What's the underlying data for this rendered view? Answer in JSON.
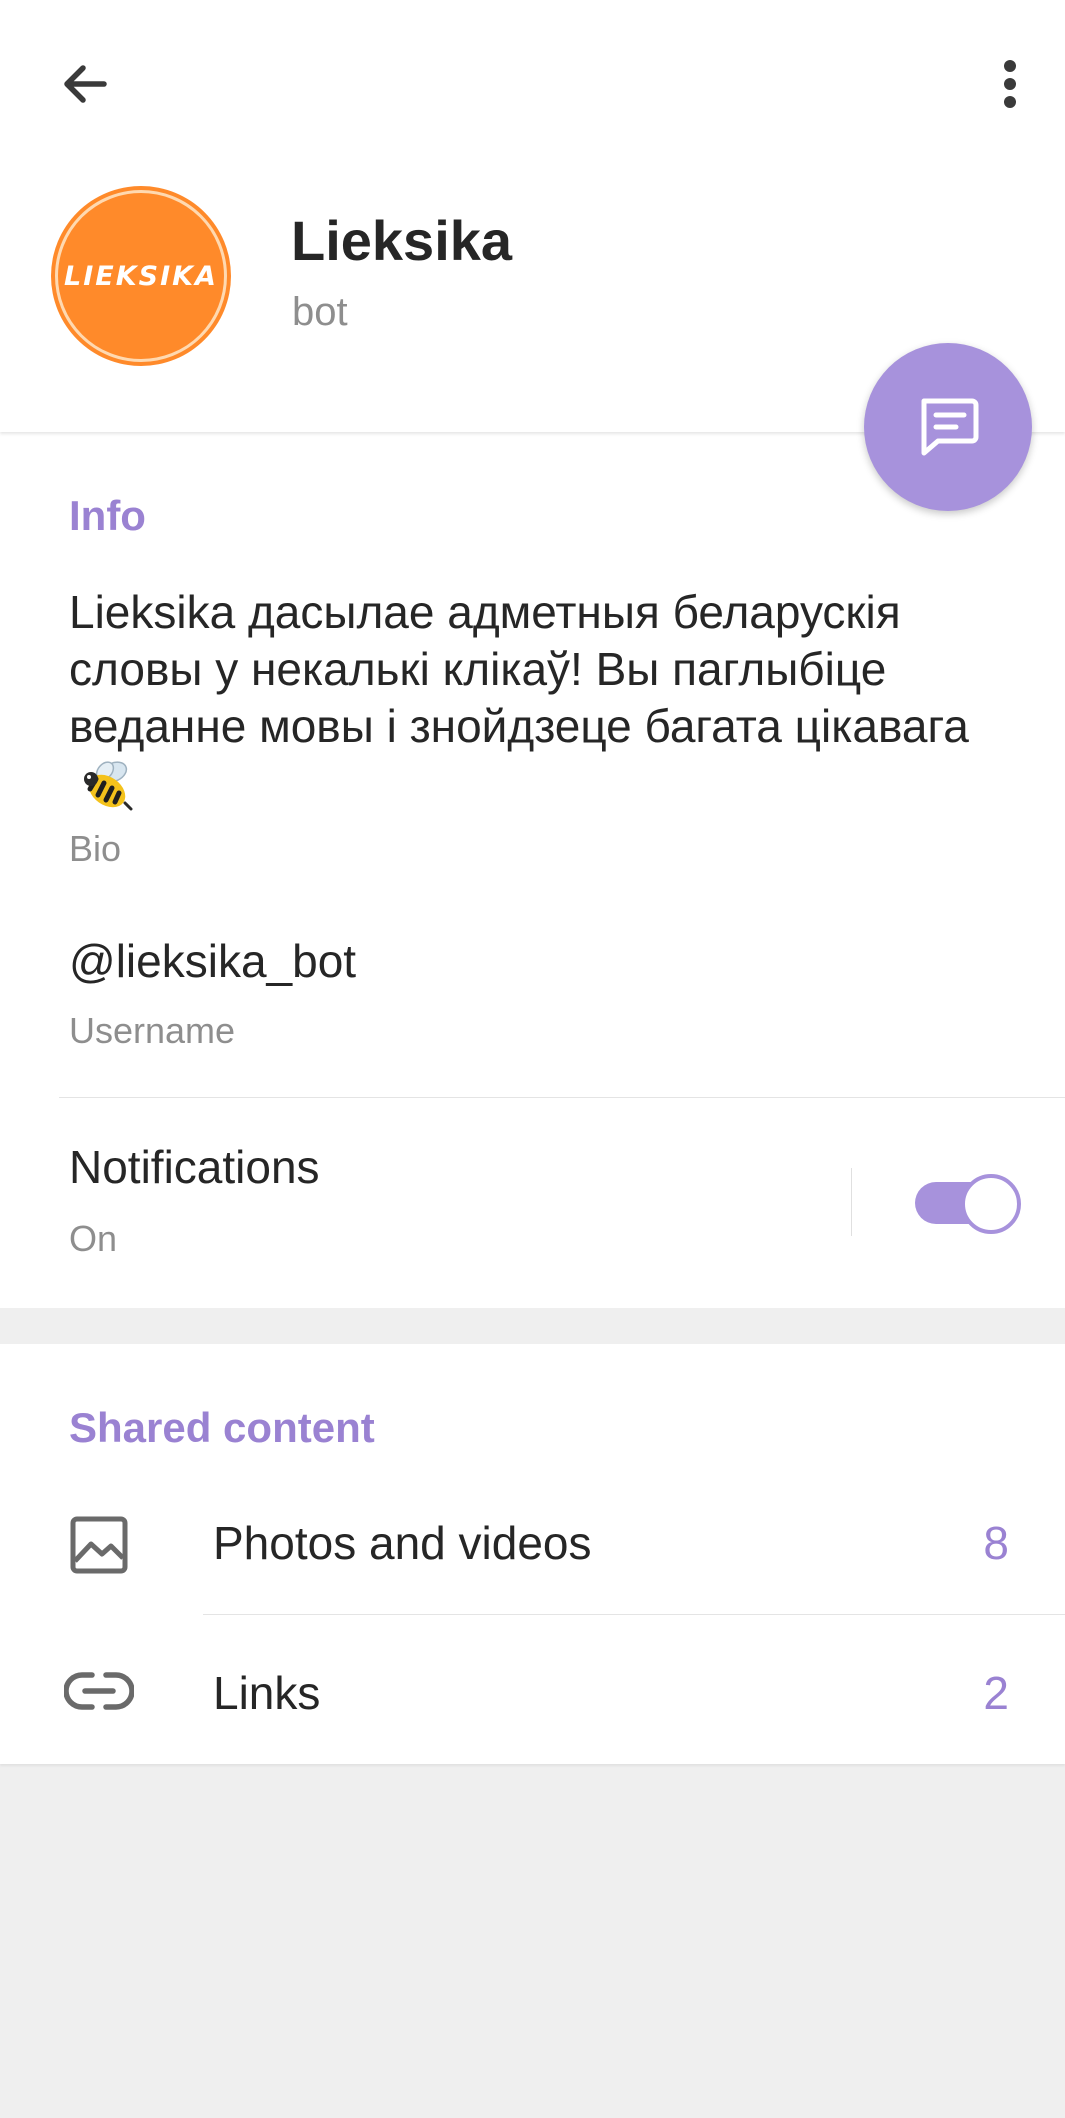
{
  "profile": {
    "avatar_text": "LIEKSIKA",
    "name": "Lieksika",
    "subtitle": "bot"
  },
  "info": {
    "title": "Info",
    "bio": "Lieksika дасылае адметныя беларускія словы у некалькі клікаў! Вы паглыбіце веданне мовы і знойдзеце багата цікавага",
    "bio_emoji": "bee-icon",
    "bio_label": "Bio",
    "username": "@lieksika_bot",
    "username_label": "Username",
    "notifications_label": "Notifications",
    "notifications_status": "On",
    "notifications_enabled": true
  },
  "shared": {
    "title": "Shared content",
    "items": [
      {
        "icon": "image-icon",
        "label": "Photos and videos",
        "count": "8"
      },
      {
        "icon": "link-icon",
        "label": "Links",
        "count": "2"
      }
    ]
  },
  "colors": {
    "accent": "#9a82d2",
    "fab": "#a792dc",
    "avatar": "#ff8a2a",
    "background": "#efefef"
  }
}
